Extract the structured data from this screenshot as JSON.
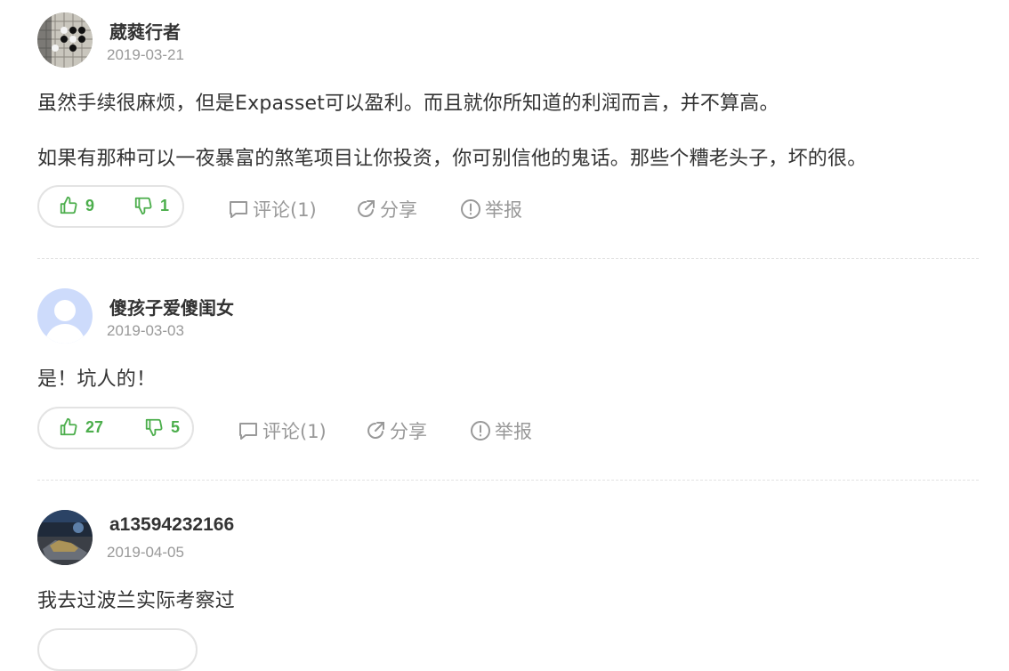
{
  "comments": [
    {
      "username": "葳蕤行者",
      "date": "2019-03-21",
      "paragraphs": [
        "虽然手续很麻烦，但是Expasset可以盈利。而且就你所知道的利润而言，并不算高。",
        "如果有那种可以一夜暴富的煞笔项目让你投资，你可别信他的鬼话。那些个糟老头子，坏的很。"
      ],
      "likes": "9",
      "dislikes": "1",
      "comment_label": "评论(1)",
      "share_label": "分享",
      "report_label": "举报"
    },
    {
      "username": "傻孩子爱傻闺女",
      "date": "2019-03-03",
      "paragraphs": [
        "是！坑人的！"
      ],
      "likes": "27",
      "dislikes": "5",
      "comment_label": "评论(1)",
      "share_label": "分享",
      "report_label": "举报"
    },
    {
      "username": "a13594232166",
      "date": "2019-04-05",
      "paragraphs": [
        "我去过波兰实际考察过"
      ]
    }
  ],
  "colors": {
    "accent_green": "#4cae4c",
    "muted": "#999999",
    "text": "#333333"
  },
  "icons": {
    "like": "thumbs-up-icon",
    "dislike": "thumbs-down-icon",
    "comment": "speech-bubble-icon",
    "share": "share-arrow-icon",
    "report": "exclamation-circle-icon"
  }
}
